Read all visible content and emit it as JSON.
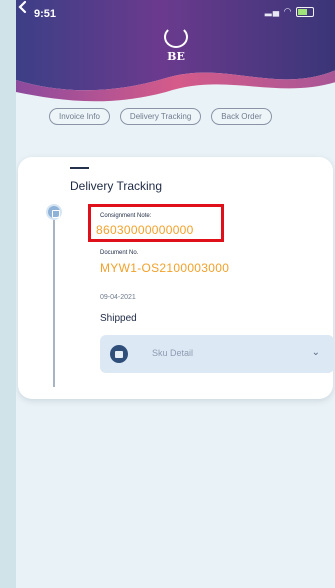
{
  "status_bar": {
    "time": "9:51"
  },
  "header": {
    "logo_text": "BE"
  },
  "tabs": [
    {
      "label": "Invoice Info"
    },
    {
      "label": "Delivery Tracking"
    },
    {
      "label": "Back Order"
    }
  ],
  "card": {
    "title": "Delivery Tracking",
    "consignment_label": "Consignment Note:",
    "consignment_value": "86030000000000",
    "document_label": "Document No.",
    "document_value": "MYW1-OS2100003000",
    "date": "09-04-2021",
    "status": "Shipped",
    "sku_label": "Sku Detail"
  },
  "colors": {
    "accent_orange": "#f2a12a",
    "highlight_red": "#e0101a",
    "header_purple": "#6b3a8e",
    "header_pink": "#d55b8a"
  }
}
